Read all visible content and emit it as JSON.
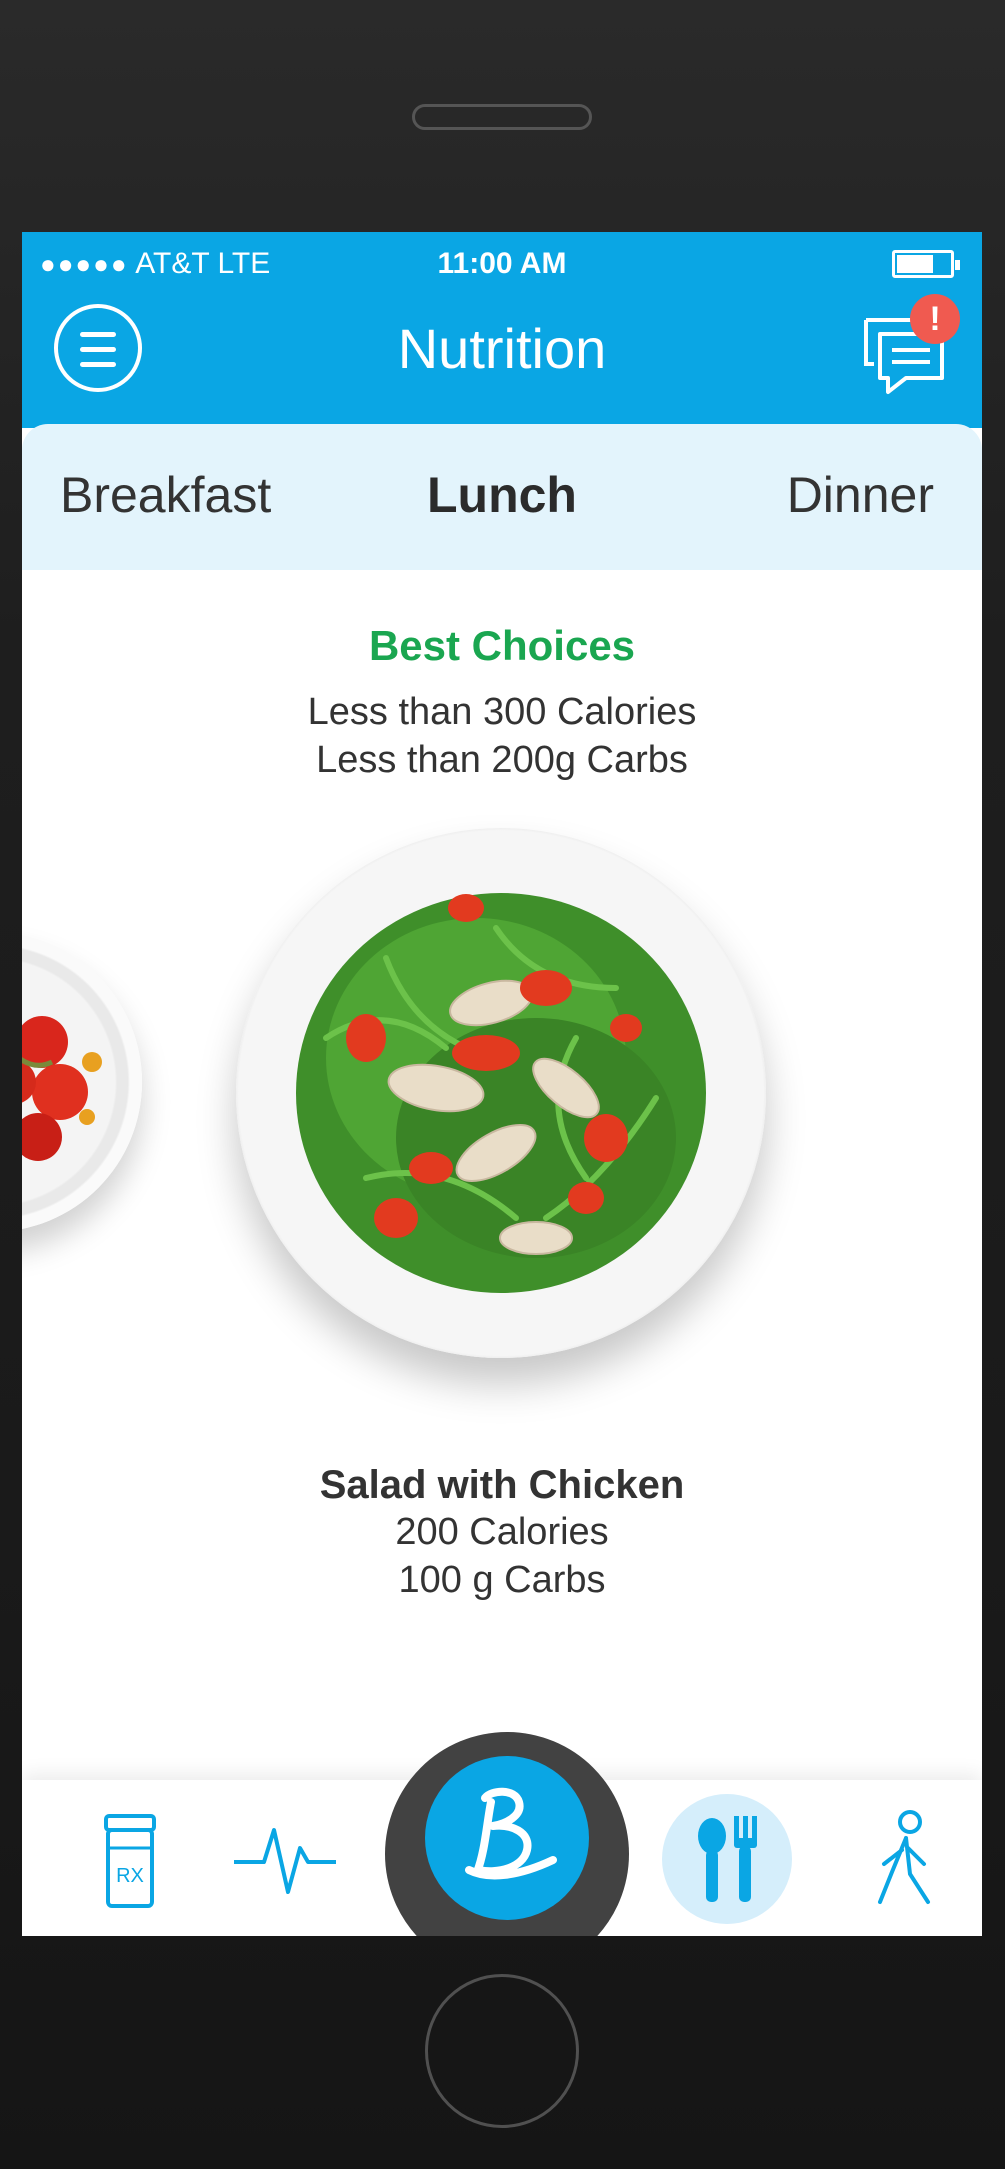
{
  "status_bar": {
    "signal": "●●●●●",
    "carrier": "AT&T  LTE",
    "time": "11:00 AM",
    "battery_level": 0.7
  },
  "header": {
    "title": "Nutrition",
    "menu_icon": "hamburger-menu-icon",
    "messages_icon": "chat-bubbles-icon",
    "alert_badge": "!"
  },
  "meal_tabs": {
    "items": [
      "Breakfast",
      "Lunch",
      "Dinner"
    ],
    "selected": "Lunch"
  },
  "recommendation": {
    "heading": "Best Choices",
    "criteria": [
      "Less than 300 Calories",
      "Less than 200g Carbs"
    ]
  },
  "dish": {
    "name": "Salad with Chicken",
    "calories": "200 Calories",
    "carbs": "100 g Carbs"
  },
  "bottom_nav": {
    "items": [
      {
        "icon": "rx-bottle-icon",
        "label": "RX"
      },
      {
        "icon": "heartbeat-icon"
      },
      {
        "icon": "home-b-logo-icon"
      },
      {
        "icon": "fork-spoon-icon",
        "active": true
      },
      {
        "icon": "walking-person-icon"
      }
    ]
  },
  "colors": {
    "primary": "#0aa6e4",
    "tab_background": "#e3f4fc",
    "heading_green": "#1aa650",
    "badge_red": "#f05a50",
    "text_dark": "#333333"
  }
}
